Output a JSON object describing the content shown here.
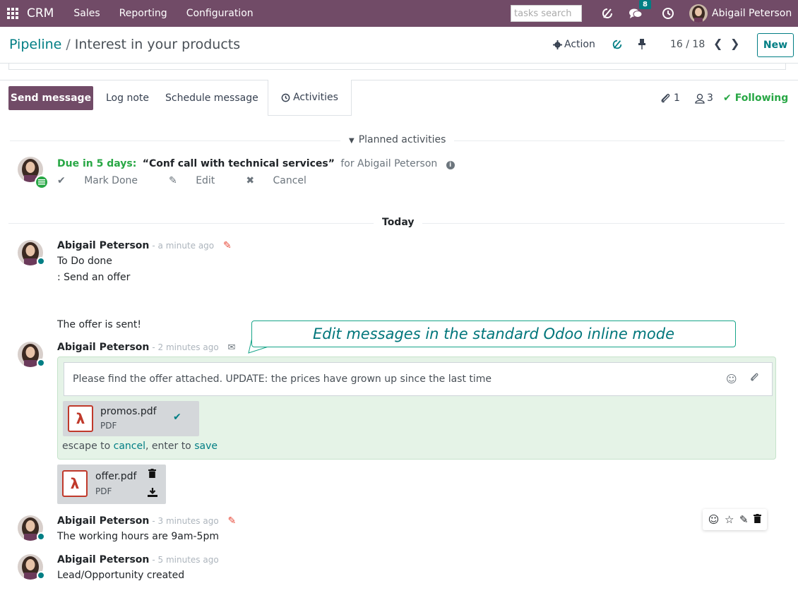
{
  "navbar": {
    "app_name": "CRM",
    "menu": [
      "Sales",
      "Reporting",
      "Configuration"
    ],
    "search_placeholder": "tasks search",
    "message_count": "8",
    "user_name": "Abigail Peterson"
  },
  "control_panel": {
    "breadcrumb_parent": "Pipeline",
    "breadcrumb_separator": "/",
    "breadcrumb_current": "Interest in your products",
    "action_label": "Action",
    "pager": "16 / 18",
    "new_label": "New"
  },
  "chatter": {
    "send_message": "Send message",
    "log_note": "Log note",
    "schedule_message": "Schedule message",
    "activities": "Activities",
    "attachments_count": "1",
    "followers_count": "3",
    "following": "Following"
  },
  "planned": {
    "label": "Planned activities",
    "due": "Due in 5 days:",
    "title": "“Conf call with technical services”",
    "for_user": "for Abigail Peterson",
    "mark_done": "Mark Done",
    "edit": "Edit",
    "cancel": "Cancel"
  },
  "today_label": "Today",
  "messages": [
    {
      "author": "Abigail Peterson",
      "date": "- a minute ago",
      "lines": [
        "To Do done",
        ": Send an offer",
        "The offer is sent!"
      ]
    },
    {
      "author": "Abigail Peterson",
      "date": "- 2 minutes ago",
      "edit_text": "Please find the offer attached. UPDATE: the prices have grown up since the last time",
      "edit_attachment": {
        "name": "promos.pdf",
        "type": "PDF"
      },
      "hint_escape": "escape to ",
      "hint_cancel": "cancel",
      "hint_enter": ", enter to ",
      "hint_save": "save",
      "attachment": {
        "name": "offer.pdf",
        "type": "PDF"
      }
    },
    {
      "author": "Abigail Peterson",
      "date": "- 3 minutes ago",
      "lines": [
        "The working hours are 9am-5pm"
      ]
    },
    {
      "author": "Abigail Peterson",
      "date": "- 5 minutes ago",
      "lines": [
        "Lead/Opportunity created"
      ]
    }
  ],
  "callout": "Edit messages in the standard Odoo inline mode",
  "colors": {
    "brand": "#714b67",
    "accent": "#017e84",
    "success": "#28a745",
    "edit_bg": "#e5f3e7"
  }
}
